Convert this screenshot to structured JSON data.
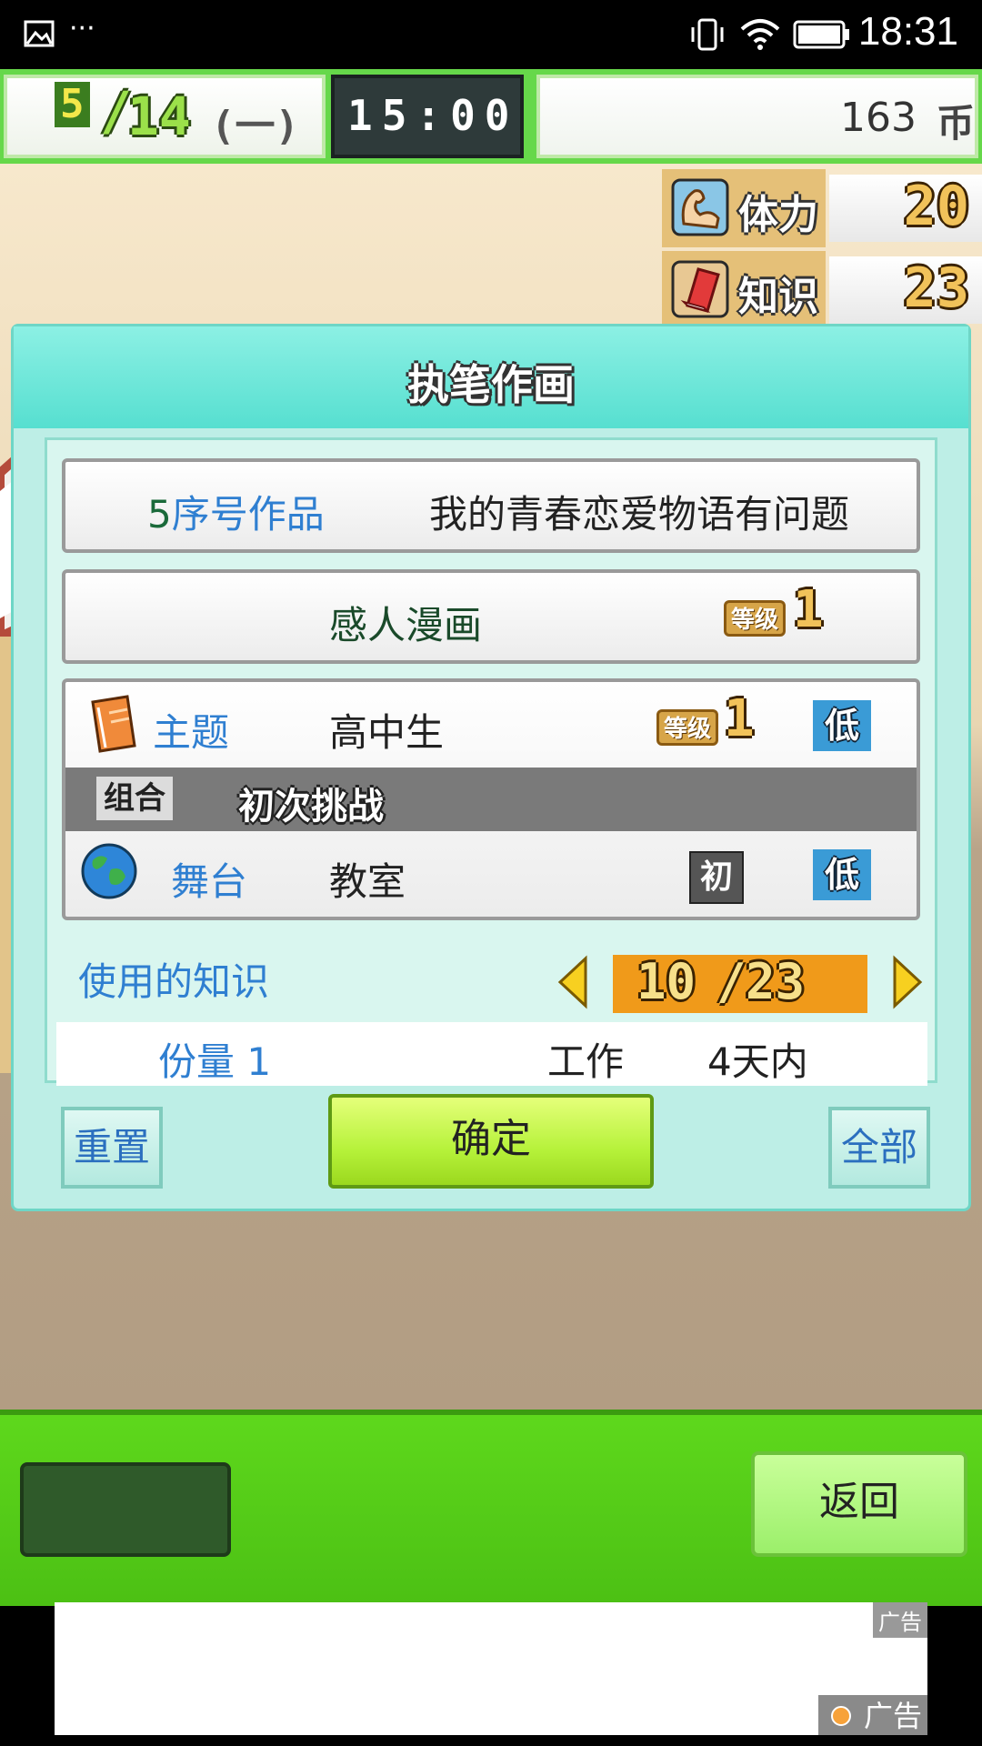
{
  "status_bar": {
    "time": "18:31",
    "icons": [
      "image-icon",
      "more-dots-icon",
      "vibrate-icon",
      "wifi-icon",
      "battery-icon"
    ],
    "more_dots": "···"
  },
  "hud": {
    "date_month": "5",
    "date_day": "14",
    "date_weekday": "(一)",
    "clock": "15:00",
    "money_value": "163",
    "money_unit": "币"
  },
  "stats": [
    {
      "icon": "muscle-arm-icon",
      "label": "体力",
      "value": "20"
    },
    {
      "icon": "red-book-icon",
      "label": "知识",
      "value": "23"
    }
  ],
  "dialog": {
    "title": "执笔作画",
    "work_number": "5序号作品",
    "work_title": "我的青春恋爱物语有问题",
    "genre": {
      "label": "感人漫画",
      "grade_badge": "等级",
      "level": "1"
    },
    "theme": {
      "icon": "orange-book-icon",
      "label": "主题",
      "value": "高中生",
      "grade_badge": "等级",
      "level": "1",
      "rating": "低"
    },
    "combo": {
      "label": "组合",
      "value": "初次挑战"
    },
    "stage": {
      "icon": "globe-icon",
      "label": "舞台",
      "value": "教室",
      "level_badge": "初",
      "rating": "低"
    },
    "knowledge": {
      "label": "使用的知识",
      "current": "10",
      "max": "23"
    },
    "summary": {
      "copies": "份量 1",
      "work_label": "工作",
      "duration": "4天内"
    },
    "buttons": {
      "reset": "重置",
      "confirm": "确定",
      "all": "全部"
    }
  },
  "bottom": {
    "back_label": "返回",
    "ad_label_top": "广告",
    "ad_label_bottom": "广告"
  },
  "colors": {
    "hud_green": "#66d84a",
    "dialog_teal": "#56dfd0",
    "confirm_green": "#b6f23a",
    "knowledge_orange": "#f09a1a",
    "accent_blue": "#2f7fd1"
  }
}
